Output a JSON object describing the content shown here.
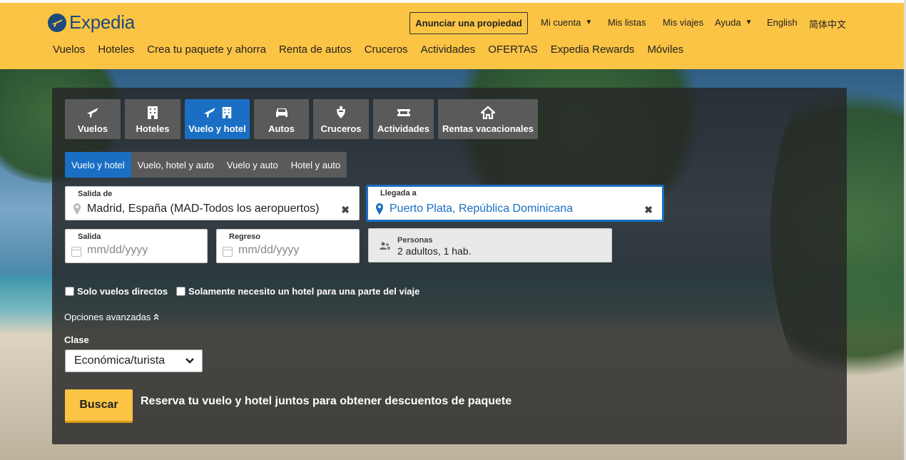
{
  "header": {
    "brand": "Expedia",
    "advertise_label": "Anunciar una propiedad",
    "utility": [
      {
        "label": "Mi cuenta",
        "has_menu": true
      },
      {
        "label": "Mis listas",
        "has_menu": false
      },
      {
        "label": "Mis viajes",
        "has_menu": false
      },
      {
        "label": "Ayuda",
        "has_menu": true
      },
      {
        "label": "English",
        "has_menu": false
      },
      {
        "label": "简体中文",
        "has_menu": false
      }
    ],
    "nav": [
      "Vuelos",
      "Hoteles",
      "Crea tu paquete y ahorra",
      "Renta de autos",
      "Cruceros",
      "Actividades",
      "OFERTAS",
      "Expedia Rewards",
      "Móviles"
    ]
  },
  "search": {
    "product_tabs": [
      {
        "label": "Vuelos",
        "icon": "plane-icon",
        "active": false
      },
      {
        "label": "Hoteles",
        "icon": "building-icon",
        "active": false
      },
      {
        "label": "Vuelo y hotel",
        "icon": "plane-building-icon",
        "active": true
      },
      {
        "label": "Autos",
        "icon": "car-icon",
        "active": false
      },
      {
        "label": "Cruceros",
        "icon": "cruise-icon",
        "active": false
      },
      {
        "label": "Actividades",
        "icon": "ticket-icon",
        "active": false
      },
      {
        "label": "Rentas vacacionales",
        "icon": "house-icon",
        "active": false
      }
    ],
    "sub_tabs": [
      {
        "label": "Vuelo y hotel",
        "active": true
      },
      {
        "label": "Vuelo, hotel y auto",
        "active": false
      },
      {
        "label": "Vuelo y auto",
        "active": false
      },
      {
        "label": "Hotel y auto",
        "active": false
      }
    ],
    "origin": {
      "label": "Salida de",
      "value": "Madrid, España (MAD-Todos los aeropuertos)"
    },
    "destination": {
      "label": "Llegada a",
      "value": "Puerto Plata, República Dominicana"
    },
    "depart": {
      "label": "Salida",
      "placeholder": "mm/dd/yyyy"
    },
    "return": {
      "label": "Regreso",
      "placeholder": "mm/dd/yyyy"
    },
    "persons": {
      "label": "Personas",
      "value": "2 adultos, 1 hab."
    },
    "checkboxes": [
      "Solo vuelos directos",
      "Solamente necesito un hotel para una parte del viaje"
    ],
    "advanced_label": "Opciones avanzadas",
    "class_label": "Clase",
    "class_value": "Económica/turista",
    "submit_label": "Buscar",
    "promo_text": "Reserva tu vuelo y hotel juntos para obtener descuentos de paquete"
  },
  "colors": {
    "brand_yellow": "#fcc444",
    "accent_blue": "#1a6fc4",
    "logo_navy": "#1d4a7a"
  }
}
